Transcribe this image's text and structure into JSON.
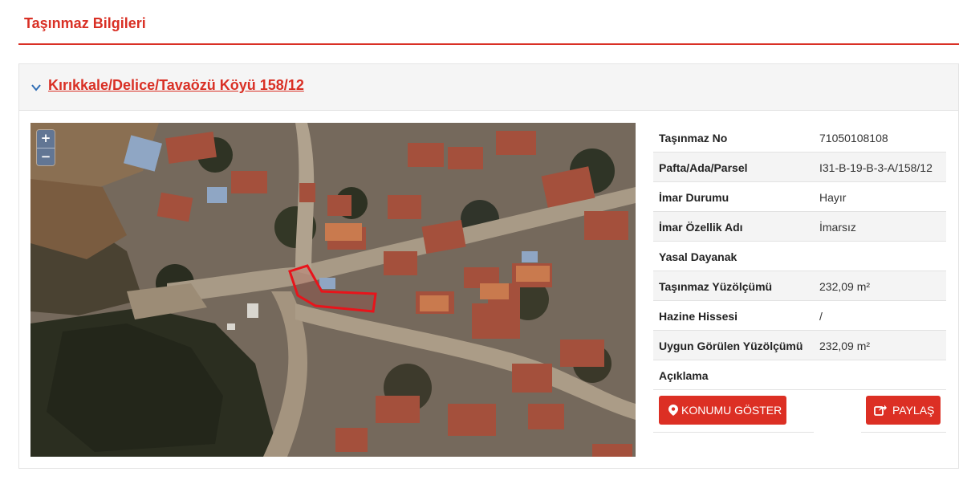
{
  "section": {
    "title": "Taşınmaz Bilgileri"
  },
  "panel": {
    "heading_link": "Kırıkkale/Delice/Tavaözü Köyü 158/12"
  },
  "map": {
    "zoom_in_label": "+",
    "zoom_out_label": "−",
    "parcel_color": "#e8141b"
  },
  "details": [
    {
      "label": "Taşınmaz No",
      "value": "71050108108"
    },
    {
      "label": "Pafta/Ada/Parsel",
      "value": "I31-B-19-B-3-A/158/12"
    },
    {
      "label": "İmar Durumu",
      "value": "Hayır"
    },
    {
      "label": "İmar Özellik Adı",
      "value": "İmarsız"
    },
    {
      "label": "Yasal Dayanak",
      "value": ""
    },
    {
      "label": "Taşınmaz Yüzölçümü",
      "value": "232,09 m²"
    },
    {
      "label": "Hazine Hissesi",
      "value": "/"
    },
    {
      "label": "Uygun Görülen Yüzölçümü",
      "value": "232,09 m²"
    },
    {
      "label": "Açıklama",
      "value": ""
    }
  ],
  "actions": {
    "show_location": "KONUMU GÖSTER",
    "share": "PAYLAŞ"
  },
  "colors": {
    "accent": "#d93025",
    "button": "#dc2f24"
  }
}
